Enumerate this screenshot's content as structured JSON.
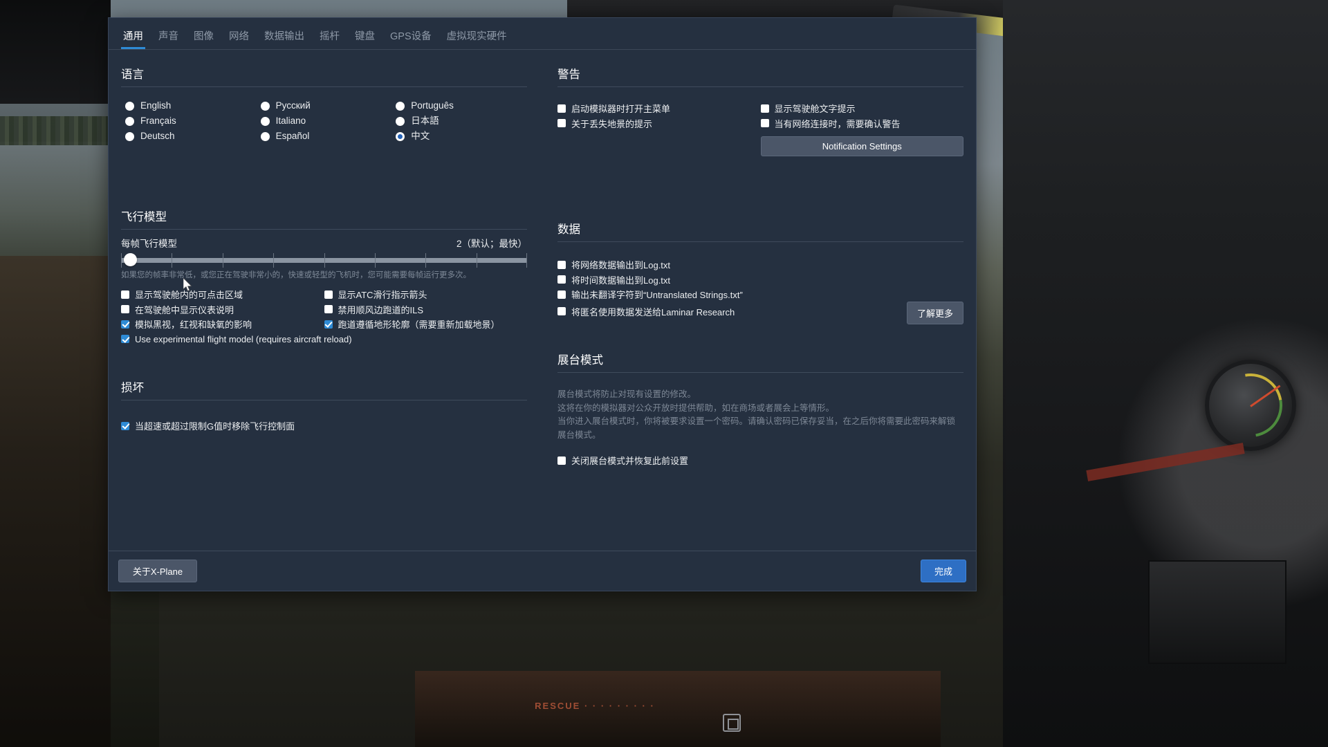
{
  "tabs": [
    {
      "label": "通用",
      "active": true
    },
    {
      "label": "声音",
      "active": false
    },
    {
      "label": "图像",
      "active": false
    },
    {
      "label": "网络",
      "active": false
    },
    {
      "label": "数据输出",
      "active": false
    },
    {
      "label": "摇杆",
      "active": false
    },
    {
      "label": "键盘",
      "active": false
    },
    {
      "label": "GPS设备",
      "active": false
    },
    {
      "label": "虚拟现实硬件",
      "active": false
    }
  ],
  "language": {
    "title": "语言",
    "columns": [
      [
        {
          "label": "English",
          "selected": false
        },
        {
          "label": "Français",
          "selected": false
        },
        {
          "label": "Deutsch",
          "selected": false
        }
      ],
      [
        {
          "label": "Русский",
          "selected": false
        },
        {
          "label": "Italiano",
          "selected": false
        },
        {
          "label": "Español",
          "selected": false
        }
      ],
      [
        {
          "label": "Português",
          "selected": false
        },
        {
          "label": "日本語",
          "selected": false
        },
        {
          "label": "中文",
          "selected": true
        }
      ]
    ]
  },
  "flight_model": {
    "title": "飞行模型",
    "slider_label": "每帧飞行模型",
    "slider_value_text": "2（默认；最快）",
    "slider_value": 2,
    "slider_min": 1,
    "slider_max": 10,
    "hint": "如果您的帧率非常低，或您正在驾驶非常小的，快速或轻型的飞机时，您可能需要每帧运行更多次。",
    "options_left": [
      {
        "label": "显示驾驶舱内的可点击区域",
        "checked": false
      },
      {
        "label": "在驾驶舱中显示仪表说明",
        "checked": false
      },
      {
        "label": "模拟黑视，红视和缺氧的影响",
        "checked": true
      },
      {
        "label": "Use experimental flight model (requires aircraft reload)",
        "checked": true
      }
    ],
    "options_right": [
      {
        "label": "显示ATC滑行指示箭头",
        "checked": false
      },
      {
        "label": "禁用顺风边跑道的ILS",
        "checked": false
      },
      {
        "label": "跑道遵循地形轮廓（需要重新加载地景）",
        "checked": true
      }
    ]
  },
  "damage": {
    "title": "损坏",
    "options": [
      {
        "label": "当超速或超过限制G值时移除飞行控制面",
        "checked": true
      }
    ]
  },
  "warnings": {
    "title": "警告",
    "options_left": [
      {
        "label": "启动模拟器时打开主菜单",
        "checked": false
      },
      {
        "label": "关于丢失地景的提示",
        "checked": false
      }
    ],
    "options_right": [
      {
        "label": "显示驾驶舱文字提示",
        "checked": false
      },
      {
        "label": "当有网络连接时，需要确认警告",
        "checked": false
      }
    ],
    "notification_button": "Notification Settings"
  },
  "data": {
    "title": "数据",
    "options": [
      {
        "label": "将网络数据输出到Log.txt",
        "checked": false
      },
      {
        "label": "将时间数据输出到Log.txt",
        "checked": false
      },
      {
        "label": "输出未翻译字符到“Untranslated Strings.txt”",
        "checked": false
      },
      {
        "label": "将匿名使用数据发送给Laminar Research",
        "checked": false
      }
    ],
    "learn_more_button": "了解更多"
  },
  "exhibition": {
    "title": "展台模式",
    "paragraphs": [
      "展台模式将防止对现有设置的修改。",
      "这将在你的模拟器对公众开放时提供帮助，如在商场或者展会上等情形。",
      "当你进入展台模式时，你将被要求设置一个密码。请确认密码已保存妥当，在之后你将需要此密码来解锁展台模式。"
    ],
    "options": [
      {
        "label": "关闭展台模式并恢复此前设置",
        "checked": false
      }
    ]
  },
  "footer": {
    "about_button": "关于X-Plane",
    "done_button": "完成"
  },
  "colors": {
    "accent": "#2e8bd6",
    "dialog_bg": "#253040",
    "done_button": "#2e6fc4",
    "radio_selected": "#2563b8"
  }
}
